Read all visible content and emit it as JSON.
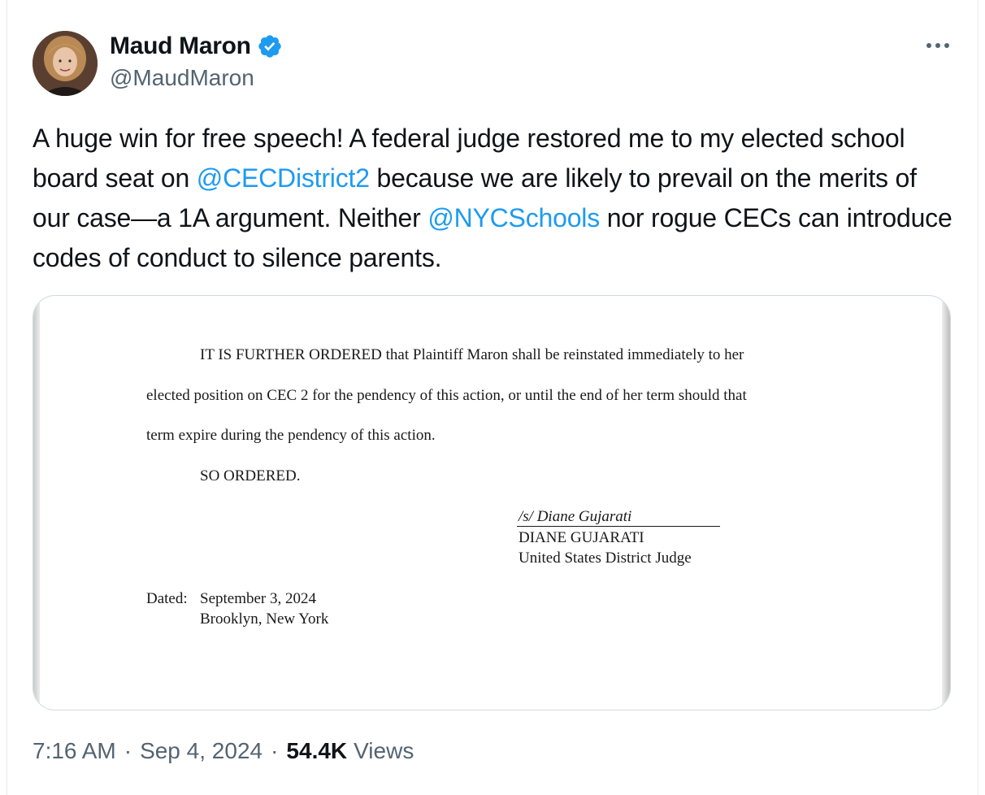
{
  "tweet": {
    "author": {
      "display_name": "Maud Maron",
      "handle": "@MaudMaron",
      "verified": true,
      "verified_icon": "verified-badge-icon",
      "avatar_icon": "avatar"
    },
    "more_icon": "more-options-icon",
    "text_segments": [
      {
        "type": "text",
        "value": "A huge win for free speech! A federal judge restored me to my elected school board seat on "
      },
      {
        "type": "mention",
        "value": "@CECDistrict2"
      },
      {
        "type": "text",
        "value": " because we are likely to prevail on the merits of our case—a 1A argument. Neither "
      },
      {
        "type": "mention",
        "value": "@NYCSchools"
      },
      {
        "type": "text",
        "value": " nor rogue CECs can introduce codes of conduct to silence parents."
      }
    ],
    "time": "7:16 AM",
    "separator": "·",
    "date": "Sep 4, 2024",
    "views_count": "54.4K",
    "views_label": "Views"
  },
  "document": {
    "para1_line1": "IT IS FURTHER ORDERED that Plaintiff Maron shall be reinstated immediately to her",
    "para1_line2": "elected position on CEC 2 for the pendency of this action, or until the end of her term should that",
    "para1_line3": "term expire during the pendency of this action.",
    "so_ordered": "SO ORDERED.",
    "signature": "/s/ Diane Gujarati",
    "signer_name": "DIANE GUJARATI",
    "signer_title": "United States District Judge",
    "dated_label": "Dated:",
    "dated_value": "September 3, 2024",
    "location": "Brooklyn, New York"
  },
  "colors": {
    "link": "#1d9bf0",
    "text": "#0f1419",
    "muted": "#536471",
    "border": "#cfd9de"
  }
}
